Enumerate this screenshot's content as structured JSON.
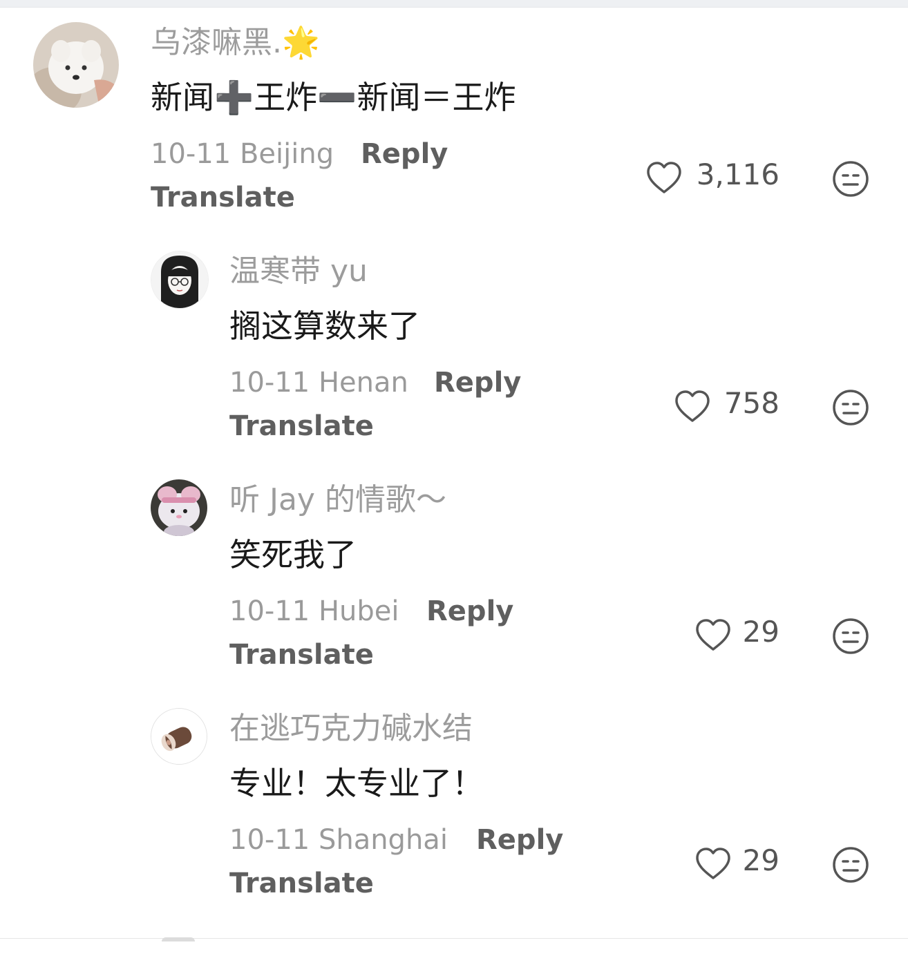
{
  "comments": [
    {
      "username": "乌漆嘛黑.🌟",
      "text": "新闻➕王炸➖新闻＝王炸",
      "date": "10-11",
      "location": "Beijing",
      "reply_label": "Reply",
      "translate_label": "Translate",
      "likes": "3,116"
    },
    {
      "username": "温寒带 yu",
      "text": "搁这算数来了",
      "date": "10-11",
      "location": "Henan",
      "reply_label": "Reply",
      "translate_label": "Translate",
      "likes": "758"
    },
    {
      "username": "听 Jay 的情歌～",
      "text": "笑死我了",
      "date": "10-11",
      "location": "Hubei",
      "reply_label": "Reply",
      "translate_label": "Translate",
      "likes": "29"
    },
    {
      "username": "在逃巧克力碱水结",
      "text": "专业！太专业了！",
      "date": "10-11",
      "location": "Shanghai",
      "reply_label": "Reply",
      "translate_label": "Translate",
      "likes": "29"
    }
  ],
  "icons": {
    "like": "heart-outline-icon",
    "dislike": "neutral-face-icon"
  },
  "colors": {
    "username": "#9c9c9c",
    "text": "#1a1a1a",
    "meta": "#9a9a9a",
    "action": "#5f5f5f"
  }
}
